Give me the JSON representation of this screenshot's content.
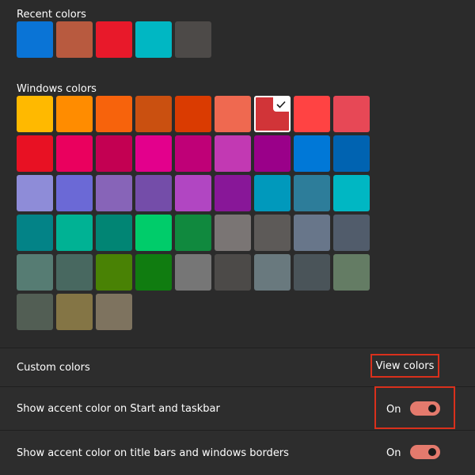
{
  "recent_colors": {
    "title": "Recent colors",
    "swatches": [
      "#0a74d6",
      "#b85a3f",
      "#e8192a",
      "#00b7c3",
      "#4d4a48"
    ]
  },
  "windows_colors": {
    "title": "Windows colors",
    "selected_color": "#d13438",
    "swatches": [
      "#ffb900",
      "#ff8c00",
      "#f7630c",
      "#ca5010",
      "#da3b01",
      "#ef6950",
      "#d13438",
      "#ff4343",
      "#e74856",
      "#e81123",
      "#ea005e",
      "#c30052",
      "#e3008c",
      "#bf0077",
      "#c239b3",
      "#9a0089",
      "#0078d7",
      "#0063b1",
      "#8e8cd8",
      "#6b69d6",
      "#8764b8",
      "#744da9",
      "#b146c2",
      "#881798",
      "#0099bc",
      "#2d7d9a",
      "#00b7c3",
      "#038387",
      "#00b294",
      "#018574",
      "#00cc6a",
      "#10893e",
      "#7a7574",
      "#5d5a58",
      "#68768a",
      "#515c6b",
      "#567c73",
      "#486860",
      "#498205",
      "#107c10",
      "#767676",
      "#4c4a48",
      "#69797e",
      "#4a5459",
      "#647c64",
      "#525e54",
      "#847545",
      "#7e735f"
    ]
  },
  "custom_colors": {
    "label": "Custom colors",
    "button_label": "View colors"
  },
  "accent_start_taskbar": {
    "label": "Show accent color on Start and taskbar",
    "state_label": "On",
    "checked": true
  },
  "accent_title_bars": {
    "label": "Show accent color on title bars and windows borders",
    "state_label": "On",
    "checked": true
  },
  "colors": {
    "background": "#2b2b2b",
    "toggle_on": "#e47a6d",
    "highlight": "#d9301c"
  }
}
